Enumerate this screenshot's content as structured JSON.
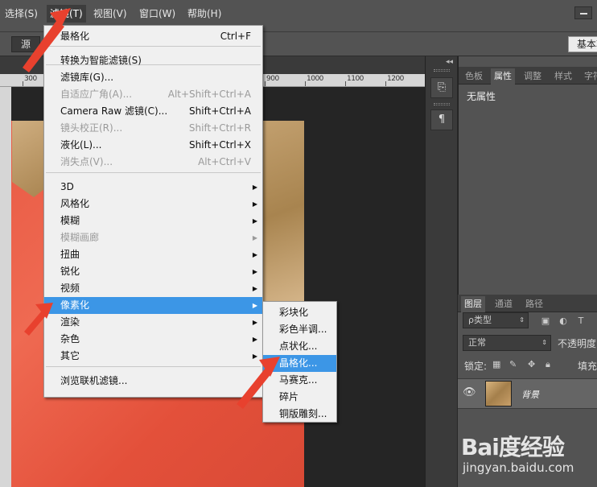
{
  "menubar": {
    "items": [
      "选择(S)",
      "滤镜(T)",
      "视图(V)",
      "窗口(W)",
      "帮助(H)"
    ]
  },
  "options": {
    "source_label": "源",
    "workspace_label": "基本功"
  },
  "ruler": {
    "ticks": [
      "300",
      "900",
      "1000",
      "1100",
      "1200"
    ]
  },
  "filter_menu": [
    {
      "label": "最格化",
      "shortcut": "Ctrl+F",
      "disabled": false
    },
    {
      "label": "转换为智能滤镜(S)",
      "shortcut": "",
      "disabled": false
    },
    {
      "label": "滤镜库(G)...",
      "shortcut": "",
      "disabled": false
    },
    {
      "label": "自适应广角(A)...",
      "shortcut": "Alt+Shift+Ctrl+A",
      "disabled": true
    },
    {
      "label": "Camera Raw 滤镜(C)...",
      "shortcut": "Shift+Ctrl+A",
      "disabled": false
    },
    {
      "label": "镜头校正(R)...",
      "shortcut": "Shift+Ctrl+R",
      "disabled": true
    },
    {
      "label": "液化(L)...",
      "shortcut": "Shift+Ctrl+X",
      "disabled": false
    },
    {
      "label": "消失点(V)...",
      "shortcut": "Alt+Ctrl+V",
      "disabled": true
    },
    {
      "label": "3D",
      "submenu": true,
      "disabled": false
    },
    {
      "label": "风格化",
      "submenu": true,
      "disabled": false
    },
    {
      "label": "模糊",
      "submenu": true,
      "disabled": false
    },
    {
      "label": "模糊画廊",
      "submenu": true,
      "disabled": true
    },
    {
      "label": "扭曲",
      "submenu": true,
      "disabled": false
    },
    {
      "label": "锐化",
      "submenu": true,
      "disabled": false
    },
    {
      "label": "视频",
      "submenu": true,
      "disabled": false
    },
    {
      "label": "像素化",
      "submenu": true,
      "disabled": false,
      "highlighted": true
    },
    {
      "label": "渲染",
      "submenu": true,
      "disabled": false
    },
    {
      "label": "杂色",
      "submenu": true,
      "disabled": false
    },
    {
      "label": "其它",
      "submenu": true,
      "disabled": false
    },
    {
      "label": "浏览联机滤镜...",
      "shortcut": "",
      "disabled": false
    }
  ],
  "pixelate_submenu": [
    {
      "label": "彩块化",
      "highlighted": false
    },
    {
      "label": "彩色半调...",
      "highlighted": false
    },
    {
      "label": "点状化...",
      "highlighted": false
    },
    {
      "label": "晶格化...",
      "highlighted": true
    },
    {
      "label": "马赛克...",
      "highlighted": false
    },
    {
      "label": "碎片",
      "highlighted": false
    },
    {
      "label": "铜版雕刻...",
      "highlighted": false
    }
  ],
  "right_panel": {
    "tabs_top": [
      "色板",
      "属性",
      "调整",
      "样式",
      "字符"
    ],
    "no_properties": "无属性",
    "tabs_layers": [
      "图层",
      "通道",
      "路径"
    ],
    "kind_filter": "ρ类型",
    "blend_mode": "正常",
    "opacity_label": "不透明度",
    "lock_label": "锁定:",
    "fill_label": "填充",
    "layer_name": "背景"
  },
  "watermark": {
    "brand": "Bai度经验",
    "url": "jingyan.baidu.com"
  },
  "colors": {
    "highlight": "#3c96e6",
    "arrow": "#e8412e"
  }
}
